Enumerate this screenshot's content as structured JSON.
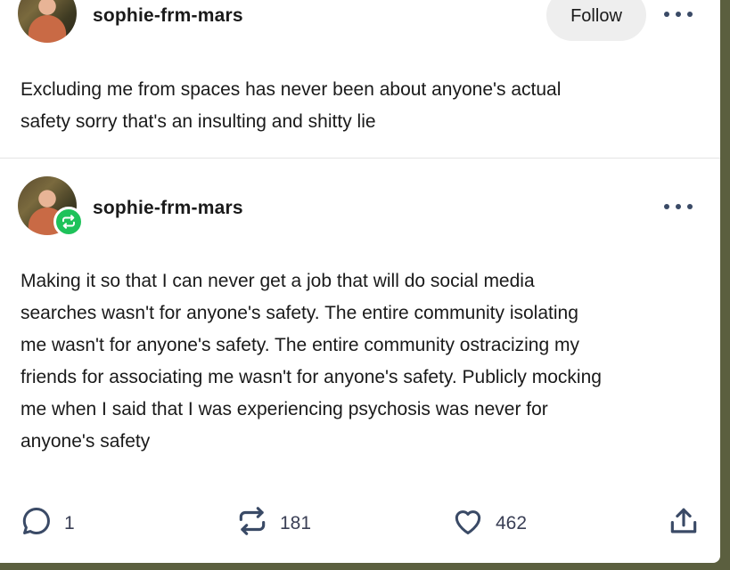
{
  "post1": {
    "username": "sophie-frm-mars",
    "follow_label": "Follow",
    "more_icon": "more-horizontal-icon",
    "text_lines": [
      "Excluding me from spaces has never been about anyone's actual",
      "safety sorry that's an insulting and shitty lie"
    ]
  },
  "post2": {
    "username": "sophie-frm-mars",
    "badge_icon": "reblog-badge-icon",
    "more_icon": "more-horizontal-icon",
    "text_lines": [
      "Making it so that I can never get a job that will do social media",
      "searches wasn't for anyone's safety. The entire community isolating",
      "me wasn't for anyone's safety. The entire community ostracizing my",
      "friends for associating me wasn't for anyone's safety. Publicly mocking",
      "me when I said that I was experiencing psychosis was never for",
      "anyone's safety"
    ]
  },
  "actions": {
    "replies": "1",
    "reblogs": "181",
    "likes": "462",
    "icons": [
      "comment-icon",
      "reblog-icon",
      "heart-icon",
      "share-icon"
    ]
  },
  "colors": {
    "reblog_badge": "#1ec25a",
    "icon": "#3a4a66",
    "page_bg": "#5b5f3f"
  }
}
